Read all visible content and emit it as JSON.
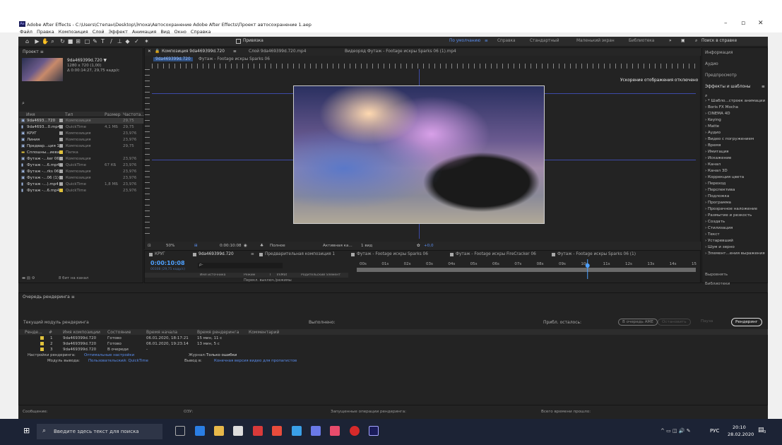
{
  "window": {
    "title": "Adobe After Effects - C:\\Users\\Степан\\Desktop\\Эпоха\\Автосохранение Adobe After Effects\\Проект автосохранение 1.aep",
    "icon": "Ae",
    "minimize": "–",
    "maximize": "▫",
    "close": "✕"
  },
  "menu": [
    "Файл",
    "Правка",
    "Композиция",
    "Слой",
    "Эффект",
    "Анимация",
    "Вид",
    "Окно",
    "Справка"
  ],
  "toolbar": {
    "snap_label": "Привязка",
    "workspaces": [
      "По умолчанию",
      "≡",
      "Справка",
      "Стандартный",
      "Маленький экран",
      "Библиотека",
      "»"
    ],
    "search_placeholder": "Поиск в справке",
    "colors": {
      "accent": "#2d8ceb",
      "workspace_active": "#5a8dee"
    }
  },
  "project": {
    "title": "Проект",
    "menu_icon": "≡",
    "comp_name": "9da469399d.720 ▼",
    "comp_res": "1280 x 720 (1,00)",
    "comp_dur": "Δ 0:00:14:27, 29,75 кадр/с",
    "search_icon": "⌕",
    "columns": [
      "Имя",
      "Тип",
      "Размер",
      "Частота..."
    ],
    "items": [
      {
        "name": "9da4693...720",
        "type": "Композиция",
        "size": "",
        "fps": "29,75",
        "color": "#a9a9a9",
        "icon": "comp"
      },
      {
        "name": "9da4693...0.mp4",
        "type": "QuickTime",
        "size": "4,1 МБ",
        "fps": "29,75",
        "color": "#a9a9a9",
        "icon": "file"
      },
      {
        "name": "КРУГ",
        "type": "Композиция",
        "size": "",
        "fps": "23,976",
        "color": "#a9a9a9",
        "icon": "comp"
      },
      {
        "name": "Линия",
        "type": "Композиция",
        "size": "",
        "fps": "23,976",
        "color": "#a9a9a9",
        "icon": "comp"
      },
      {
        "name": "Предвар...ция 1",
        "type": "Композиция",
        "size": "",
        "fps": "29,75",
        "color": "#a9a9a9",
        "icon": "comp"
      },
      {
        "name": "Сплошны...иевая",
        "type": "Папка",
        "size": "",
        "fps": "",
        "color": "#e0c23c",
        "icon": "folder"
      },
      {
        "name": "Футаж -...ker 06",
        "type": "Композиция",
        "size": "",
        "fps": "23,976",
        "color": "#a9a9a9",
        "icon": "comp"
      },
      {
        "name": "Футаж -...6.mp4",
        "type": "QuickTime",
        "size": "67 КБ",
        "fps": "23,976",
        "color": "#a9a9a9",
        "icon": "file"
      },
      {
        "name": "Футаж -...rks 06",
        "type": "Композиция",
        "size": "",
        "fps": "23,976",
        "color": "#a9a9a9",
        "icon": "comp"
      },
      {
        "name": "Футаж -...06 (1)",
        "type": "Композиция",
        "size": "",
        "fps": "23,976",
        "color": "#a9a9a9",
        "icon": "comp"
      },
      {
        "name": "Футаж -...).mp4",
        "type": "QuickTime",
        "size": "1,8 МБ",
        "fps": "23,976",
        "color": "#a9a9a9",
        "icon": "file"
      },
      {
        "name": "Футаж -...6.mp4",
        "type": "QuickTime",
        "size": "",
        "fps": "23,976",
        "color": "#e0c23c",
        "icon": "file"
      }
    ],
    "footer": "8 бит на канал"
  },
  "viewer": {
    "tabs": [
      "Композиция 9da469399d.720",
      "≡",
      "Слой 9da469399d.720.mp4",
      "Видеоряд Футаж - Footage искры Sparks 06 (1).mp4"
    ],
    "subtabs": [
      "9da469399d.720",
      "Футаж - Footage искры Sparks 06"
    ],
    "notice": "Ускорение отображения отключено",
    "zoom": "50%",
    "timecode": "0:00:10:08",
    "quality": "Полное",
    "camera": "Активная ка...",
    "views": "1 вид",
    "exposure": "+0,0"
  },
  "timeline": {
    "tabs": [
      "КРУГ",
      "9da469399d.720",
      "≡",
      "Предварительная композиция 1",
      "Футаж - Footage искры Sparks 06",
      "Футаж - Footage искры FireCracker 06",
      "Футаж - Footage искры Sparks 06 (1)"
    ],
    "timecode": "0:00:10:08",
    "fps_note": "00308 (29,75 кадр/с)",
    "search_placeholder": "ρ-",
    "columns": [
      "Имя источника",
      "Режим",
      "T",
      "TrkMat",
      "Родительский элемент"
    ],
    "footer": "Перекл. выключ./режимы",
    "ruler": [
      "00s",
      "01s",
      "02s",
      "03s",
      "04s",
      "05s",
      "06s",
      "07s",
      "08s",
      "09s",
      "10s",
      "11s",
      "12s",
      "13s",
      "14s",
      "15"
    ],
    "playhead": 10.3,
    "duration": 15
  },
  "right_panels": {
    "items": [
      "Информация",
      "Аудио",
      "Предпросмотр",
      "Эффекты и шаблоны",
      "≡"
    ],
    "effects": [
      "* Шабло...строек анимации",
      "Boris FX Mocha",
      "CINEMA 4D",
      "Keying",
      "Matte",
      "Аудио",
      "Видео с погружением",
      "Время",
      "Имитация",
      "Искажение",
      "Канал",
      "Канал 3D",
      "Коррекция цвета",
      "Переход",
      "Перспектива",
      "Подложка",
      "Программа",
      "Прозрачное наложение",
      "Размытие и резкость",
      "Создать",
      "Стилизация",
      "Текст",
      "Устаревший",
      "Шум и зерно",
      "Элемент...ения выражения"
    ],
    "bottom": [
      "Выровнять",
      "Библиотеки"
    ]
  },
  "render": {
    "title": "Очередь рендеринга",
    "menu_icon": "≡",
    "module": "Текущий модуль рендеринга",
    "done_label": "Выполнено:",
    "remain_label": "Прибл. осталось:",
    "queue_btn": "В очередь AME",
    "stop_btn": "Остановить",
    "pause_btn": "Пауза",
    "render_btn": "Рендеринг",
    "columns": [
      "Ренде...",
      "#",
      "Имя композиции",
      "Состояние",
      "Время начала",
      "Время рендеринга",
      "Комментарий"
    ],
    "rows": [
      {
        "n": "1",
        "name": "9da469399d.720",
        "status": "Готово",
        "start": "06.01.2020, 18:17:21",
        "time": "15 мин, 11 с"
      },
      {
        "n": "2",
        "name": "9da469399d.720",
        "status": "Готово",
        "start": "06.01.2020, 19:23:14",
        "time": "13 мин, 5 с"
      },
      {
        "n": "3",
        "name": "9da469399d.720",
        "status": "В очереди",
        "start": "-",
        "time": ""
      }
    ],
    "settings_label": "Настройки рендеринга:",
    "settings_value": "Оптимальные настройки",
    "journal_label": "Журнал:",
    "journal_value": "Только ошибки",
    "output_label": "Модуль вывода:",
    "output_value": "Пользовательский: QuickTime",
    "output_to_label": "Вывод в:",
    "output_to_value": "Конечная версия видео для пропагистов"
  },
  "status_bar": {
    "messages": "Сообщение:",
    "ram": "ОЗУ:",
    "started": "Запущенные операции рендеринга:",
    "total": "Всего времени прошло:"
  },
  "taskbar": {
    "search_placeholder": "Введите здесь текст для поиска",
    "lang": "РУС",
    "time": "20:10",
    "date": "28.02.2020",
    "notif": "3"
  }
}
